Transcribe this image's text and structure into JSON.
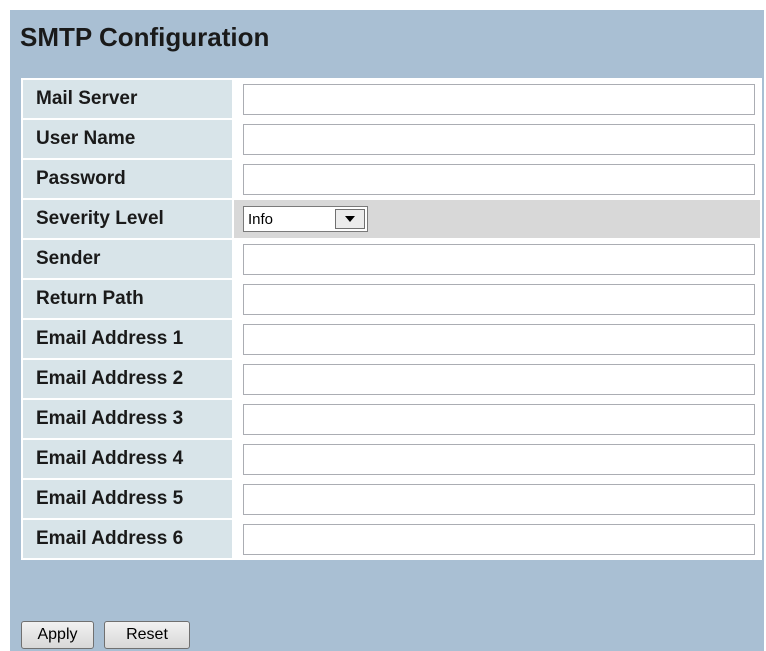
{
  "page": {
    "title": "SMTP Configuration"
  },
  "form": {
    "mail_server": {
      "label": "Mail Server",
      "value": ""
    },
    "user_name": {
      "label": "User Name",
      "value": ""
    },
    "password": {
      "label": "Password",
      "value": ""
    },
    "severity_level": {
      "label": "Severity Level",
      "selected": "Info"
    },
    "sender": {
      "label": "Sender",
      "value": ""
    },
    "return_path": {
      "label": "Return Path",
      "value": ""
    },
    "email_1": {
      "label": "Email Address 1",
      "value": ""
    },
    "email_2": {
      "label": "Email Address 2",
      "value": ""
    },
    "email_3": {
      "label": "Email Address 3",
      "value": ""
    },
    "email_4": {
      "label": "Email Address 4",
      "value": ""
    },
    "email_5": {
      "label": "Email Address 5",
      "value": ""
    },
    "email_6": {
      "label": "Email Address 6",
      "value": ""
    }
  },
  "buttons": {
    "apply": "Apply",
    "reset": "Reset"
  },
  "colors": {
    "panel_background": "#a9bfd3",
    "label_cell": "#d8e4e9",
    "severity_row": "#d8d8d8"
  }
}
